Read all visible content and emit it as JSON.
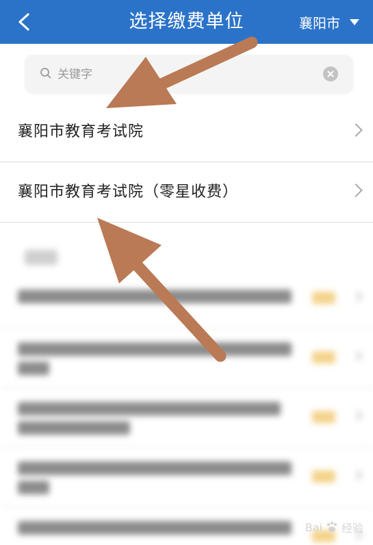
{
  "header": {
    "title": "选择缴费单位",
    "city": "襄阳市",
    "bg_color": "#2b73c8"
  },
  "search": {
    "placeholder": "关键字",
    "value": ""
  },
  "units": [
    {
      "label": "襄阳市教育考试院"
    },
    {
      "label": "襄阳市教育考试院（零星收费）"
    }
  ],
  "icons": {
    "back": "back-arrow-icon",
    "dropdown": "triangle-down-icon",
    "search": "search-icon",
    "clear": "clear-icon",
    "chevron": "chevron-right-icon"
  },
  "annotation": {
    "arrow_color": "#b97a55"
  },
  "watermark": {
    "text_left": "Bai",
    "text_right": "经验"
  }
}
